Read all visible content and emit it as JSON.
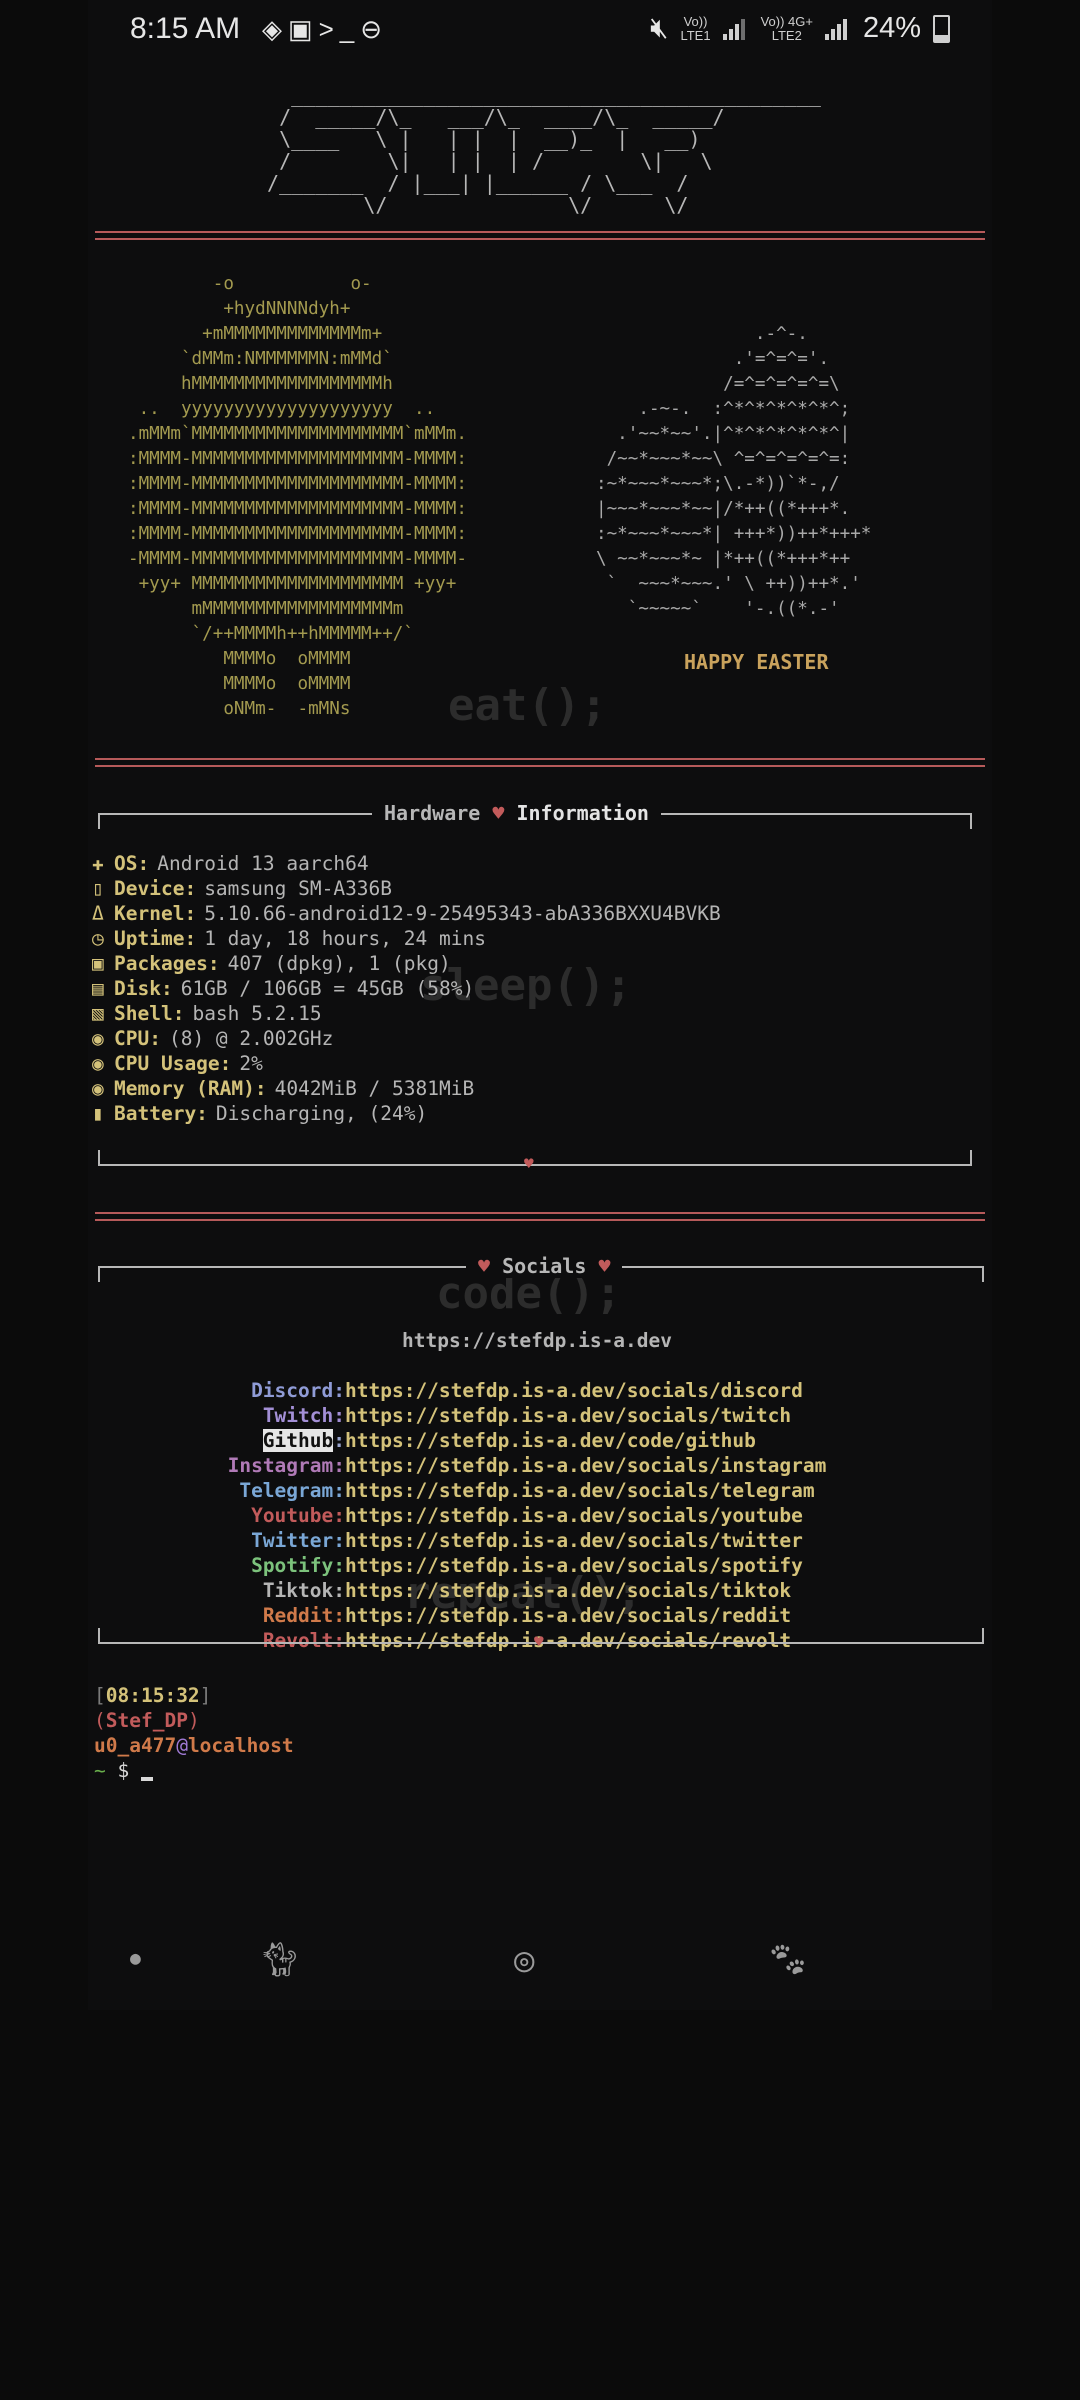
{
  "status_bar": {
    "time": "8:15 AM",
    "left_icons": [
      "layers-icon",
      "image-icon",
      "terminal-icon",
      "dnd-icon"
    ],
    "sim1": "LTE1",
    "sim2": "LTE2",
    "sim1_label": "Vo))",
    "sim2_label": "Vo)) 4G+",
    "battery": "24%",
    "battery_level": 0.24
  },
  "banner": {
    "ascii": "   ____________________________________________\n  /  _____/\\_   ___/\\_  ____/\\_  _____/\n  \\____   \\ |   | |  |  __)_  |   __)\n  /        \\|   | |  | /        \\|   \\\n /_______  / |___| |______ / \\___  /\n         \\/               \\/      \\/"
  },
  "skull_ascii": "        -o           o-\n         +hydNNNNdyh+\n       +mMMMMMMMMMMMMMm+\n     `dMMm:NMMMMMMN:mMMd`\n     hMMMMMMMMMMMMMMMMMMh\n ..  yyyyyyyyyyyyyyyyyyyy  ..\n.mMMm`MMMMMMMMMMMMMMMMMMMM`mMMm.\n:MMMM-MMMMMMMMMMMMMMMMMMMM-MMMM:\n:MMMM-MMMMMMMMMMMMMMMMMMMM-MMMM:\n:MMMM-MMMMMMMMMMMMMMMMMMMM-MMMM:\n:MMMM-MMMMMMMMMMMMMMMMMMMM-MMMM:\n-MMMM-MMMMMMMMMMMMMMMMMMMM-MMMM-\n +yy+ MMMMMMMMMMMMMMMMMMMM +yy+\n      mMMMMMMMMMMMMMMMMMMm\n      `/++MMMMh++hMMMMM++/`\n         MMMMo  oMMMM\n         MMMMo  oMMMM\n         oNMm-  -mMNs",
  "egg_ascii": "               .-^-.\n             .'=^=^='.\n            /=^=^=^=^=\\\n    .-~-.  :^*^*^*^*^*^;\n  .'~~*~~'.|^*^*^*^*^*^|\n /~~*~~~*~~\\ ^=^=^=^=^=:\n:~*~~~*~~~*;\\.-*))`*-,/\n|~~~*~~~*~~|/*++((*+++*.\n:~*~~~*~~~*| +++*))++*+++*\n\\ ~~*~~~*~ |*++((*+++*++\n `  ~~~*~~~.' \\ ++))++*.'\n   `~~~~~`    '-.((*.-'",
  "easter_label": "HAPPY EASTER",
  "watermarks": [
    "eat();",
    "sleep();",
    "code();",
    "repeat();"
  ],
  "hardware": {
    "title_left": "Hardware",
    "title_right": "Information",
    "rows": [
      {
        "icon": "android-icon",
        "glyph": "✚",
        "key": "OS:",
        "value": "Android 13 aarch64"
      },
      {
        "icon": "phone-icon",
        "glyph": "▯",
        "key": "Device:",
        "value": "samsung SM-A336B"
      },
      {
        "icon": "kernel-icon",
        "glyph": "Δ",
        "key": "Kernel:",
        "value": "5.10.66-android12-9-25495343-abA336BXXU4BVKB"
      },
      {
        "icon": "clock-icon",
        "glyph": "◷",
        "key": "Uptime:",
        "value": "1 day, 18 hours, 24 mins"
      },
      {
        "icon": "package-icon",
        "glyph": "▣",
        "key": "Packages:",
        "value": "407 (dpkg), 1 (pkg)"
      },
      {
        "icon": "disk-icon",
        "glyph": "▤",
        "key": "Disk:",
        "value": "61GB / 106GB = 45GB (58%)"
      },
      {
        "icon": "shell-icon",
        "glyph": "▧",
        "key": "Shell:",
        "value": "bash 5.2.15"
      },
      {
        "icon": "cpu-icon",
        "glyph": "◉",
        "key": "CPU:",
        "value": "(8) @ 2.002GHz"
      },
      {
        "icon": "cpu-usage-icon",
        "glyph": "◉",
        "key": "CPU Usage:",
        "value": "2%"
      },
      {
        "icon": "memory-icon",
        "glyph": "◉",
        "key": "Memory (RAM):",
        "value": "4042MiB / 5381MiB"
      },
      {
        "icon": "battery-icon",
        "glyph": "▮",
        "key": "Battery:",
        "value": "Discharging, (24%)"
      }
    ]
  },
  "socials": {
    "title": "Socials",
    "homepage": "https://stefdp.is-a.dev",
    "rows": [
      {
        "name": "Discord:",
        "url": "https://stefdp.is-a.dev/socials/discord",
        "color": "#8f9bd6"
      },
      {
        "name": "Twitch:",
        "url": "https://stefdp.is-a.dev/socials/twitch",
        "color": "#a38fd6"
      },
      {
        "name": "Github",
        "suffix": ":",
        "url": "https://stefdp.is-a.dev/code/github",
        "color": "#111111",
        "highlight": true
      },
      {
        "name": "Instagram:",
        "url": "https://stefdp.is-a.dev/socials/instagram",
        "color": "#b07ab7"
      },
      {
        "name": "Telegram:",
        "url": "https://stefdp.is-a.dev/socials/telegram",
        "color": "#7aa7d6"
      },
      {
        "name": "Youtube:",
        "url": "https://stefdp.is-a.dev/socials/youtube",
        "color": "#c25b5b"
      },
      {
        "name": "Twitter:",
        "url": "https://stefdp.is-a.dev/socials/twitter",
        "color": "#7aa7d6"
      },
      {
        "name": "Spotify:",
        "url": "https://stefdp.is-a.dev/socials/spotify",
        "color": "#7cc27c"
      },
      {
        "name": "Tiktok:",
        "url": "https://stefdp.is-a.dev/socials/tiktok",
        "color": "#b5b5b5"
      },
      {
        "name": "Reddit:",
        "url": "https://stefdp.is-a.dev/socials/reddit",
        "color": "#d07a4a"
      },
      {
        "name": "Revolt:",
        "url": "https://stefdp.is-a.dev/socials/revolt",
        "color": "#c25b5b"
      }
    ]
  },
  "prompt": {
    "time": "08:15:32",
    "user_tag": "Stef_DP",
    "user": "u0_a477",
    "host": "localhost",
    "symbol": "$"
  },
  "nav_bar": {
    "icons": [
      "home-dot-icon",
      "menu-cat-icon",
      "home-cat-icon",
      "back-cat-icon"
    ]
  }
}
